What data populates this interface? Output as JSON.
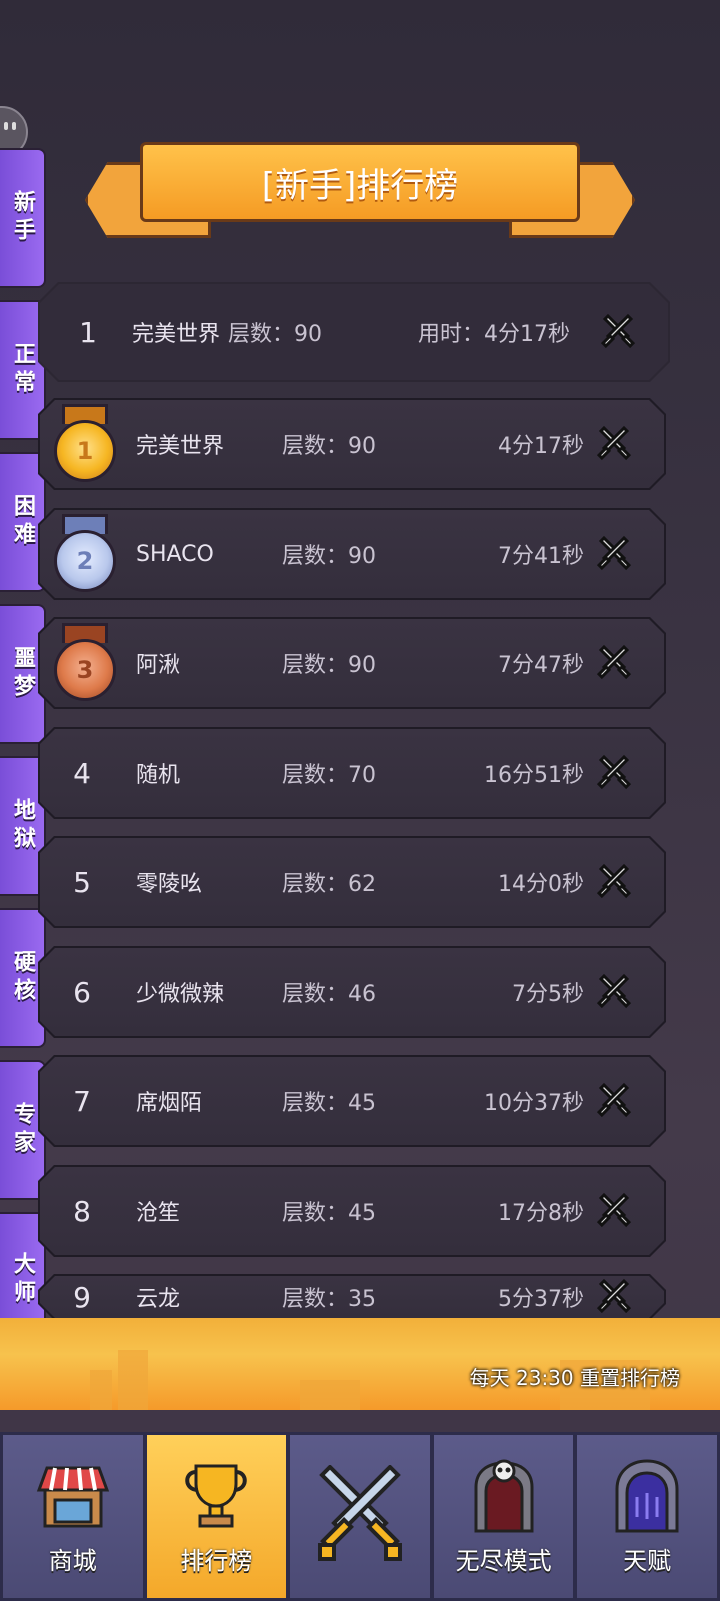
{
  "banner_title": "[新手]排行榜",
  "side_tabs": [
    {
      "label": "新手",
      "active": true
    },
    {
      "label": "正常",
      "active": false
    },
    {
      "label": "困难",
      "active": false
    },
    {
      "label": "噩梦",
      "active": false
    },
    {
      "label": "地狱",
      "active": false
    },
    {
      "label": "硬核",
      "active": false
    },
    {
      "label": "专家",
      "active": false
    },
    {
      "label": "大师",
      "active": false
    }
  ],
  "my_record": {
    "rank": "1",
    "name": "完美世界",
    "floor": "层数：90",
    "time": "用时：4分17秒"
  },
  "rows": [
    {
      "rank": "1",
      "medal": "gold",
      "name": "完美世界",
      "floor": "层数：90",
      "time": "4分17秒"
    },
    {
      "rank": "2",
      "medal": "silver",
      "name": "SHACO",
      "floor": "层数：90",
      "time": "7分41秒"
    },
    {
      "rank": "3",
      "medal": "bronze",
      "name": "阿湫",
      "floor": "层数：90",
      "time": "7分47秒"
    },
    {
      "rank": "4",
      "medal": null,
      "name": "随机",
      "floor": "层数：70",
      "time": "16分51秒"
    },
    {
      "rank": "5",
      "medal": null,
      "name": "零陵吆",
      "floor": "层数：62",
      "time": "14分0秒"
    },
    {
      "rank": "6",
      "medal": null,
      "name": "少微微辣",
      "floor": "层数：46",
      "time": "7分5秒"
    },
    {
      "rank": "7",
      "medal": null,
      "name": "席烟陌",
      "floor": "层数：45",
      "time": "10分37秒"
    },
    {
      "rank": "8",
      "medal": null,
      "name": "沧笙",
      "floor": "层数：45",
      "time": "17分8秒"
    },
    {
      "rank": "9",
      "medal": null,
      "name": "云龙",
      "floor": "层数：35",
      "time": "5分37秒"
    }
  ],
  "reset_notice": "每天 23:30 重置排行榜",
  "nav": [
    {
      "label": "商城",
      "icon": "shop-icon",
      "active": false
    },
    {
      "label": "排行榜",
      "icon": "trophy-icon",
      "active": true
    },
    {
      "label": "",
      "icon": "crossed-swords-icon",
      "active": false
    },
    {
      "label": "无尽模式",
      "icon": "skull-gate-icon",
      "active": false
    },
    {
      "label": "天赋",
      "icon": "portal-gate-icon",
      "active": false
    }
  ],
  "colors": {
    "side_tab": "#8a5ce6",
    "banner": "#f7a62e",
    "gold": "#f6b622",
    "silver": "#b9c8ec",
    "bronze": "#de7a4a",
    "nav_bg": "#55547f",
    "nav_active": "#f9be40"
  }
}
